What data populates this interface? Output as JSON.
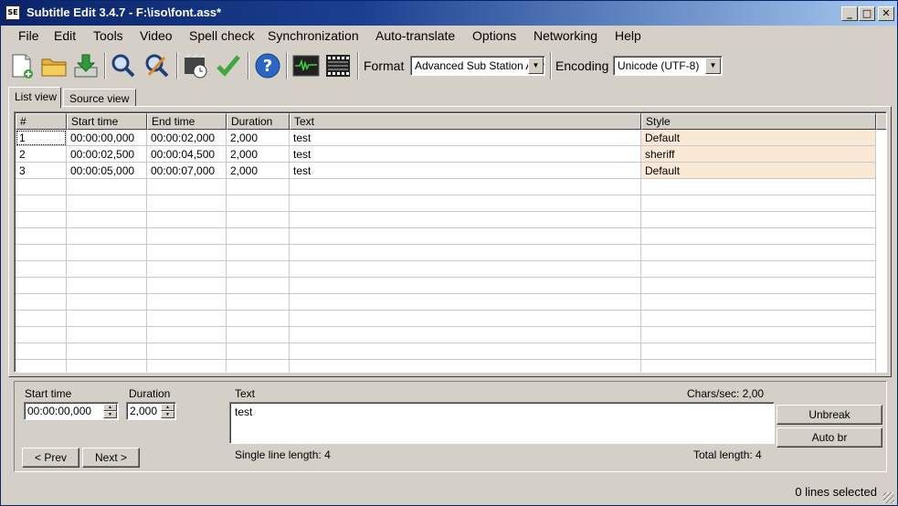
{
  "window": {
    "title": "Subtitle Edit 3.4.7 - F:\\iso\\font.ass*",
    "app_icon_text": "SE"
  },
  "menu": [
    "File",
    "Edit",
    "Tools",
    "Video",
    "Spell check",
    "Synchronization",
    "Auto-translate",
    "Options",
    "Networking",
    "Help"
  ],
  "toolbar": {
    "format_label": "Format",
    "format_value": "Advanced Sub Station Alpha",
    "encoding_label": "Encoding",
    "encoding_value": "Unicode (UTF-8)",
    "icons": [
      "new-file-icon",
      "open-folder-icon",
      "download-icon",
      "find-icon",
      "replace-icon",
      "video-clock-icon",
      "spell-check-icon",
      "help-icon",
      "waveform-icon",
      "film-clapper-icon"
    ]
  },
  "tabs": {
    "list_view": "List view",
    "source_view": "Source view"
  },
  "table": {
    "headers": [
      "#",
      "Start time",
      "End time",
      "Duration",
      "Text",
      "Style"
    ],
    "rows": [
      [
        "1",
        "00:00:00,000",
        "00:00:02,000",
        "2,000",
        "test",
        "Default"
      ],
      [
        "2",
        "00:00:02,500",
        "00:00:04,500",
        "2,000",
        "test",
        "sheriff"
      ],
      [
        "3",
        "00:00:05,000",
        "00:00:07,000",
        "2,000",
        "test",
        "Default"
      ]
    ]
  },
  "editor": {
    "start_time_label": "Start time",
    "start_time_value": "00:00:00,000",
    "duration_label": "Duration",
    "duration_value": "2,000",
    "text_label": "Text",
    "chars_sec": "Chars/sec: 2,00",
    "text_value": "test",
    "single_line_length": "Single line length: 4",
    "total_length": "Total length: 4",
    "prev_button": "< Prev",
    "next_button": "Next >",
    "unbreak_button": "Unbreak",
    "auto_br_button": "Auto br"
  },
  "status": {
    "text": "0 lines selected"
  },
  "colors": {
    "titlebar_start": "#0a246a",
    "titlebar_end": "#a6caf0",
    "style_highlight": "#fbe9d7",
    "chrome": "#d4d0c8"
  }
}
